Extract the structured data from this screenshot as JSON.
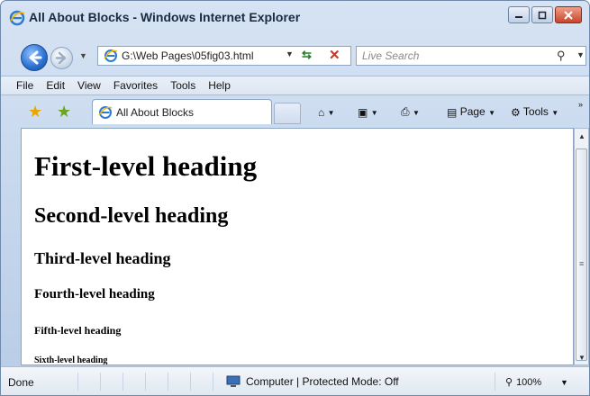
{
  "window": {
    "title": "All About Blocks - Windows Internet Explorer",
    "controls": [
      "minimize",
      "restore",
      "close"
    ]
  },
  "address_bar": {
    "url": "G:\\Web Pages\\05fig03.html",
    "search_placeholder": "Live Search"
  },
  "menu": {
    "items": [
      "File",
      "Edit",
      "View",
      "Favorites",
      "Tools",
      "Help"
    ]
  },
  "tab": {
    "label": "All About Blocks"
  },
  "commands": {
    "page": "Page",
    "tools": "Tools"
  },
  "content": {
    "h1": "First-level heading",
    "h2": "Second-level heading",
    "h3": "Third-level heading",
    "h4": "Fourth-level heading",
    "h5": "Fifth-level heading",
    "h6": "Sixth-level heading"
  },
  "status": {
    "left": "Done",
    "zone": "Computer | Protected Mode: Off",
    "zoom": "100%"
  },
  "icons": {
    "ie": "ie-logo-icon",
    "back": "back-arrow-icon",
    "forward": "forward-arrow-icon",
    "refresh": "refresh-icon",
    "stop": "stop-icon",
    "search": "search-icon",
    "favorites": "favorites-star-icon",
    "add_favorites": "add-favorites-icon",
    "home": "home-icon",
    "feeds": "feeds-icon",
    "print": "print-icon",
    "page": "page-icon",
    "tools": "gear-icon",
    "computer": "computer-icon",
    "zoom": "zoom-icon"
  },
  "colors": {
    "frame": "#c3d5ec",
    "close_button": "#c8442a",
    "link_blue": "#2a6fd1"
  }
}
